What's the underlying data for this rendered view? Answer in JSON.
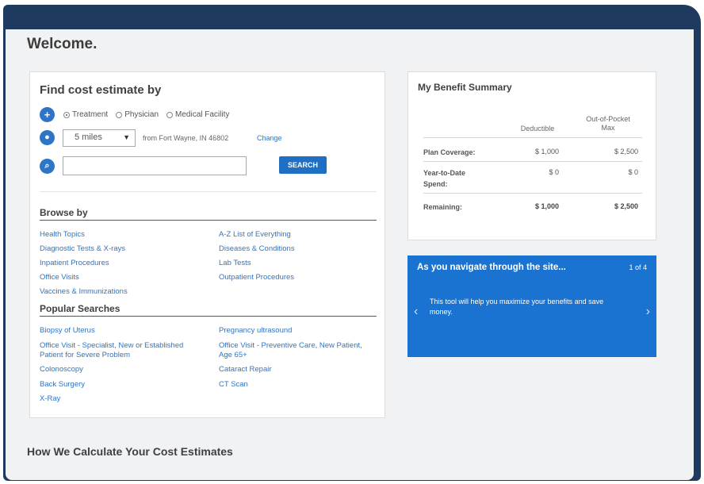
{
  "welcome": "Welcome.",
  "find": {
    "title": "Find cost estimate by",
    "radios": [
      "Treatment",
      "Physician",
      "Medical Facility"
    ],
    "distance": "5 miles",
    "from": "from Fort Wayne, IN 46802",
    "change": "Change",
    "search_placeholder": "",
    "search_button": "SEARCH"
  },
  "browse": {
    "title": "Browse by",
    "left": [
      "Health Topics",
      "Diagnostic Tests & X-rays",
      "Inpatient Procedures",
      "Office Visits",
      "Vaccines & Immunizations"
    ],
    "right": [
      "A-Z List of Everything",
      "Diseases & Conditions",
      "Lab Tests",
      "Outpatient Procedures"
    ]
  },
  "popular": {
    "title": "Popular Searches",
    "left": [
      "Biopsy of Uterus",
      "Office Visit - Specialist, New or Established",
      "Patient for Severe Problem",
      "Colonoscopy",
      "Back Surgery",
      "X-Ray"
    ],
    "right": [
      "Pregnancy ultrasound",
      "Office Visit - Preventive Care, New Patient,",
      "Age 65+",
      "Cataract Repair",
      "CT Scan"
    ]
  },
  "benefit": {
    "title": "My Benefit Summary",
    "col1": "Deductible",
    "col2_line1": "Out-of-Pocket",
    "col2_line2": "Max",
    "rows": [
      {
        "label1": "Plan Coverage:",
        "label2": "",
        "v1": "$ 1,000",
        "v2": "$ 2,500"
      },
      {
        "label1": "Year-to-Date",
        "label2": "Spend:",
        "v1": "$ 0",
        "v2": "$ 0"
      },
      {
        "label1": "Remaining:",
        "label2": "",
        "v1": "$ 1,000",
        "v2": "$ 2,500"
      }
    ]
  },
  "nav": {
    "title": "As you navigate through the site...",
    "count": "1 of 4",
    "text": "This tool will help you maximize your benefits and save money."
  },
  "how": "How We Calculate Your Cost Estimates",
  "colors": {
    "frame": "#1e3a5f",
    "accent": "#1a73d1",
    "link": "#2e74c7"
  }
}
